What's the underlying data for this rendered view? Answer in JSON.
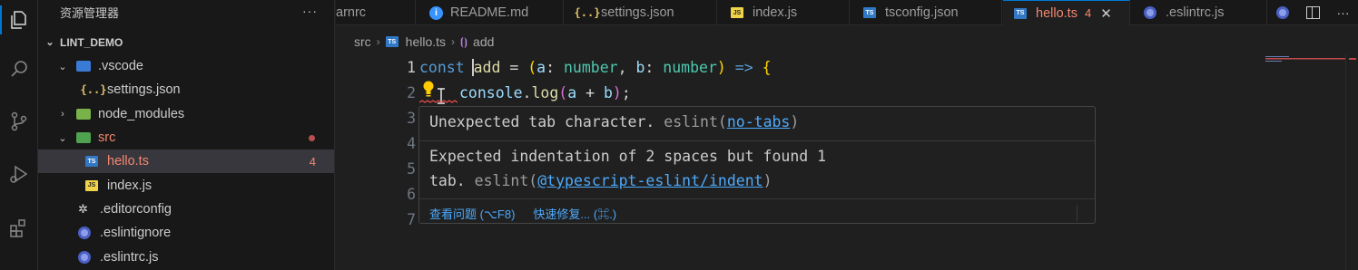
{
  "sidebar": {
    "title": "资源管理器",
    "more": "···",
    "section": "LINT_DEMO",
    "items": [
      {
        "label": ".vscode"
      },
      {
        "label": "settings.json"
      },
      {
        "label": "node_modules"
      },
      {
        "label": "src"
      },
      {
        "label": "hello.ts",
        "badge": "4"
      },
      {
        "label": "index.js"
      },
      {
        "label": ".editorconfig"
      },
      {
        "label": ".eslintignore"
      },
      {
        "label": ".eslintrc.js"
      }
    ]
  },
  "tabs": [
    {
      "label": "arnrc"
    },
    {
      "label": "README.md"
    },
    {
      "label": "settings.json"
    },
    {
      "label": "index.js"
    },
    {
      "label": "tsconfig.json"
    },
    {
      "label": "hello.ts",
      "badge": "4"
    },
    {
      "label": ".eslintrc.js"
    }
  ],
  "breadcrumb": {
    "folder": "src",
    "file": "hello.ts",
    "symbol": "add"
  },
  "editor": {
    "lines": [
      "1",
      "2",
      "3",
      "4",
      "5",
      "6",
      "7"
    ],
    "line1": {
      "kw": "const",
      "name": "add",
      "eq": " = ",
      "p1": "(",
      "a": "a",
      "c1": ": ",
      "t1": "number",
      "comma": ", ",
      "b": "b",
      "c2": ": ",
      "t2": "number",
      "p2": ")",
      "arrow": " => ",
      "brace": "{"
    },
    "line2": {
      "obj": "console",
      "dot": ".",
      "fn": "log",
      "p1": "(",
      "a": "a",
      "plus": " + ",
      "b": "b",
      "p2": ")",
      "semi": ";"
    }
  },
  "hover": {
    "msg1": {
      "text": "Unexpected tab character. ",
      "source": "eslint(",
      "rule": "no-tabs",
      "close": ")"
    },
    "msg2": {
      "line1": "Expected indentation of 2 spaces but found 1",
      "line2": "tab. ",
      "source": "eslint(",
      "rule": "@typescript-eslint/indent",
      "close": ")"
    },
    "view_problem": "查看问题 (⌥F8)",
    "quick_fix": "快速修复... (⌘.)"
  },
  "colors": {
    "accent": "#0078d4",
    "error": "#f48771",
    "link": "#4daafc"
  }
}
